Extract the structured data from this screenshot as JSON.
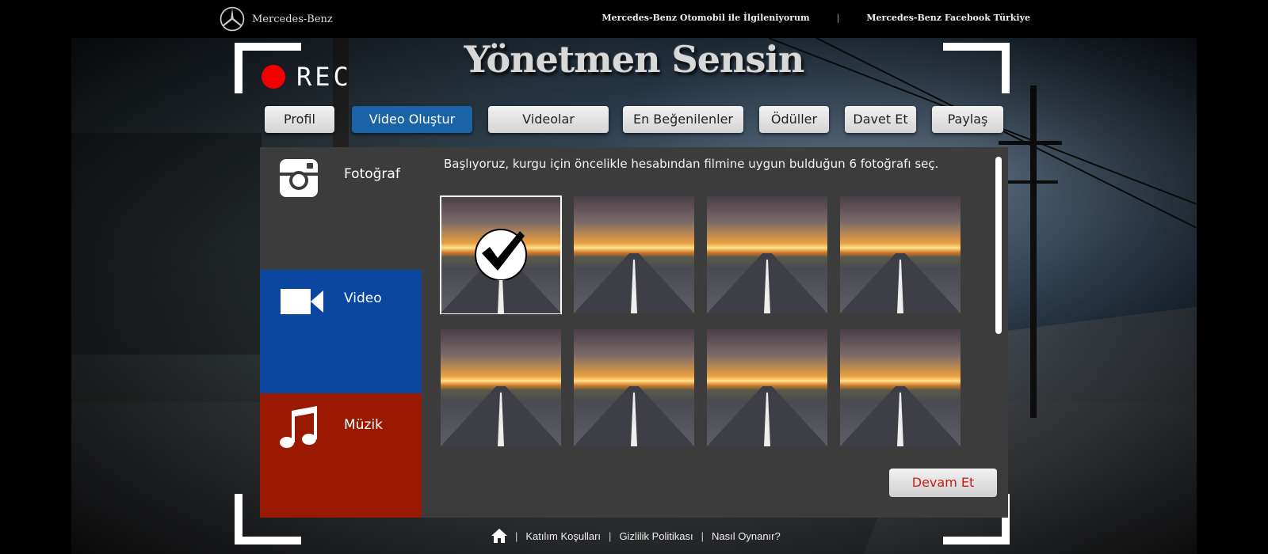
{
  "header": {
    "brand": "Mercedes-Benz",
    "links": [
      "Mercedes-Benz Otomobil ile İlgileniyorum",
      "Mercedes-Benz Facebook Türkiye"
    ],
    "separator": "|"
  },
  "hero": {
    "rec_label": "REC",
    "title": "Yönetmen Sensin"
  },
  "nav": {
    "items": [
      {
        "label": "Profil"
      },
      {
        "label": "Video Oluştur",
        "active": true
      },
      {
        "label": "Videolar"
      },
      {
        "label": "En Beğenilenler"
      },
      {
        "label": "Ödüller"
      },
      {
        "label": "Davet Et"
      },
      {
        "label": "Paylaş"
      }
    ]
  },
  "sidebar": {
    "items": [
      {
        "label": "Fotoğraf",
        "icon": "instagram-icon"
      },
      {
        "label": "Video",
        "icon": "video-camera-icon",
        "color": "#0b47a0"
      },
      {
        "label": "Müzik",
        "icon": "music-note-icon",
        "color": "#991a00"
      }
    ]
  },
  "main": {
    "instruction": "Başlıyoruz, kurgu için öncelikle hesabından filmine uygun bulduğun 6 fotoğrafı seç.",
    "photo_count": 8,
    "selected_index": 0,
    "next_label": "Devam Et"
  },
  "footer": {
    "links": [
      "Katılım Koşulları",
      "Gizlilik Politikası",
      "Nasıl Oynanır?"
    ],
    "separator": "|",
    "home_icon": "home-icon"
  }
}
